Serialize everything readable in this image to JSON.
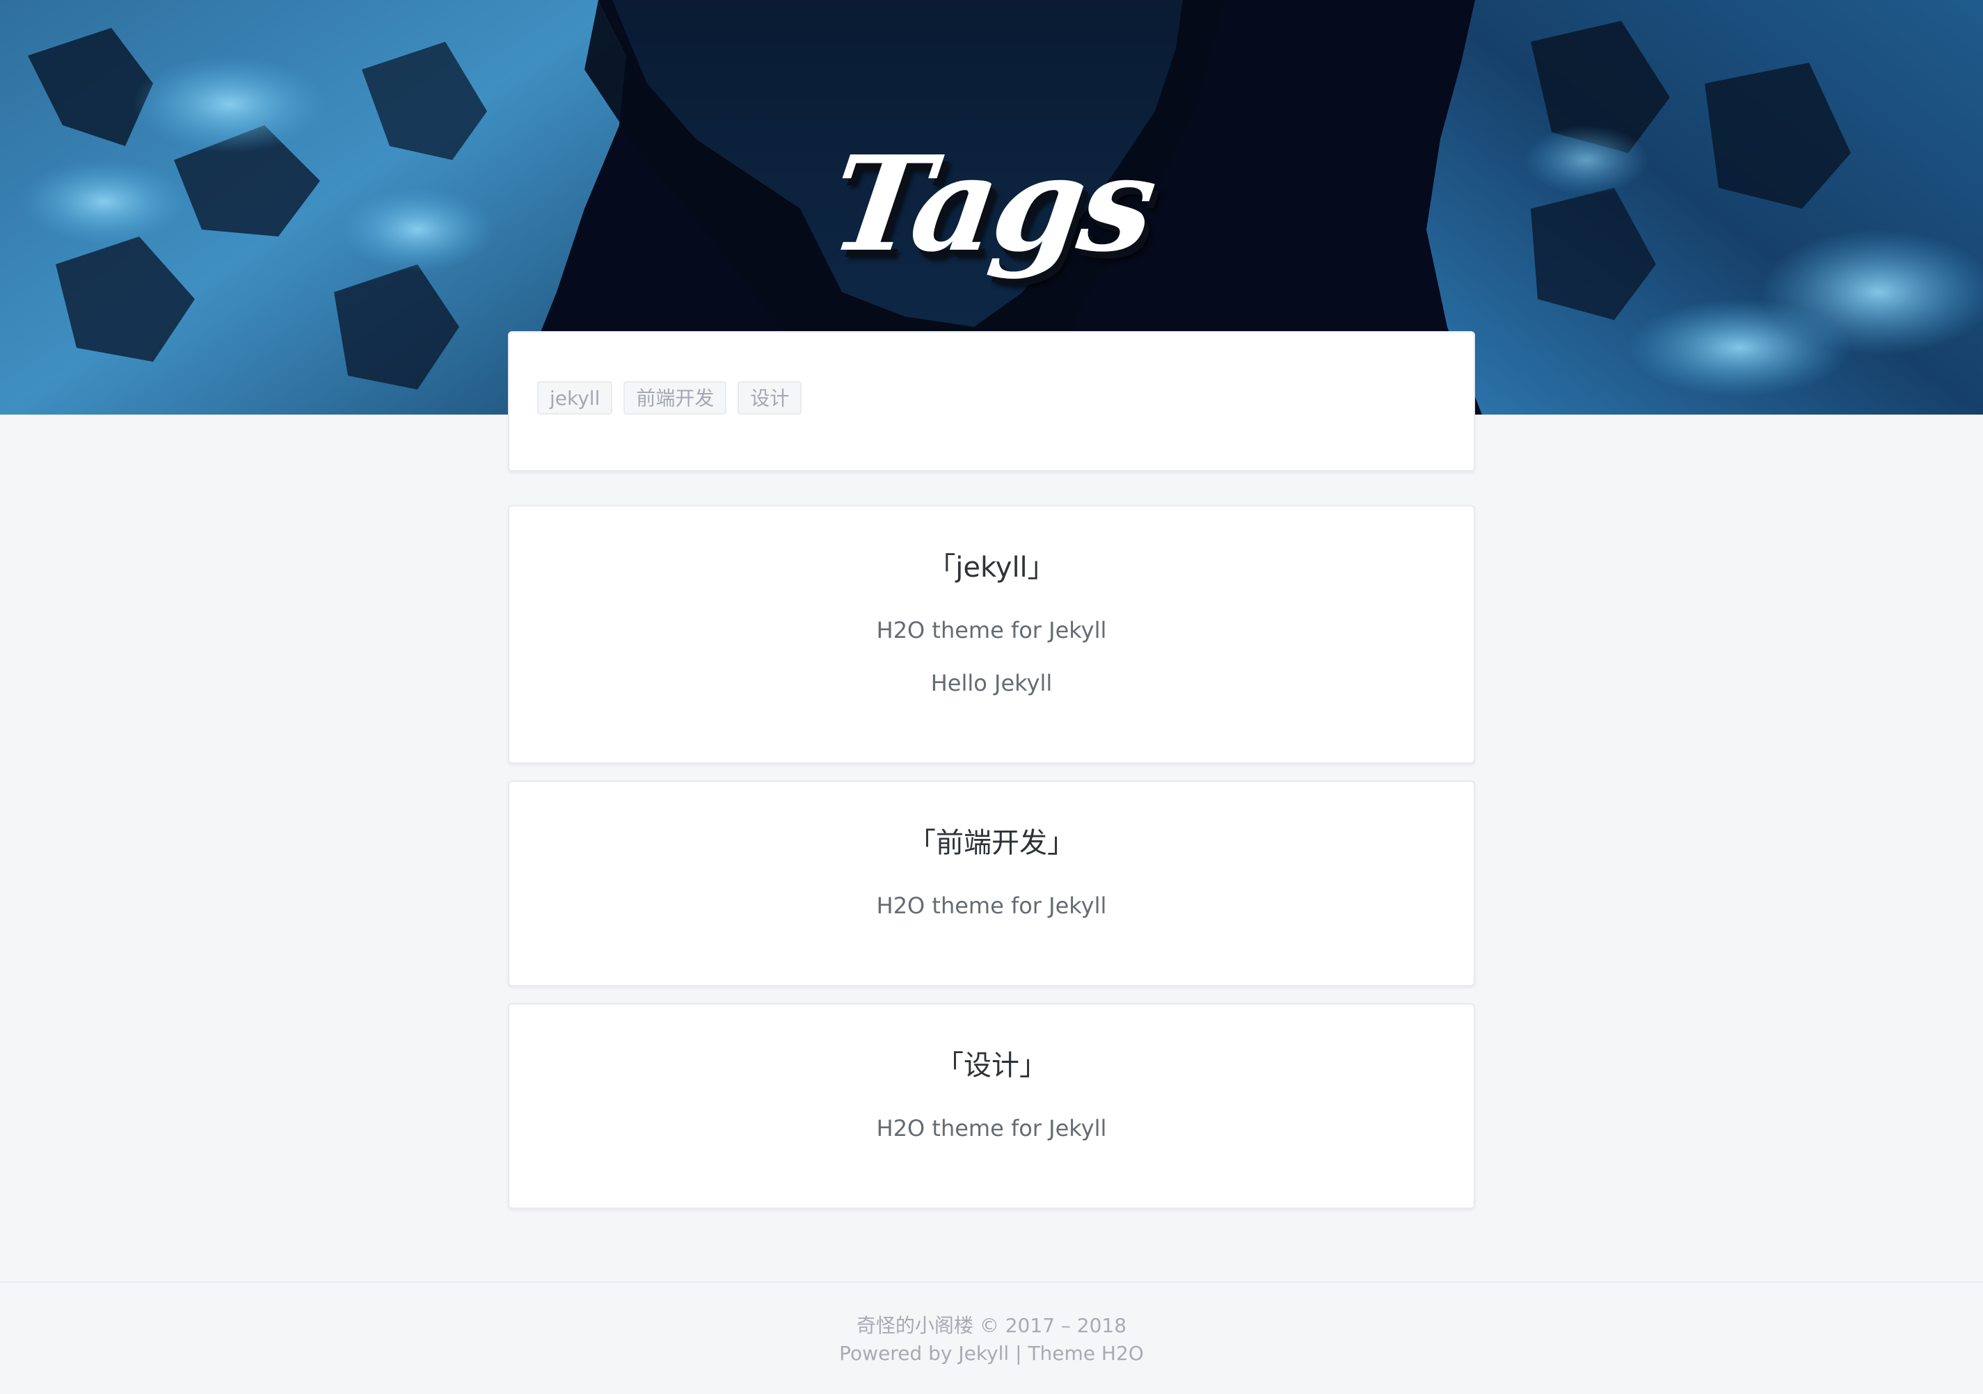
{
  "hero": {
    "title": "Tags"
  },
  "tags": [
    {
      "label": "jekyll"
    },
    {
      "label": "前端开发"
    },
    {
      "label": "设计"
    }
  ],
  "sections": [
    {
      "title": "「jekyll」",
      "posts": [
        "H2O theme for Jekyll",
        "Hello Jekyll"
      ]
    },
    {
      "title": "「前端开发」",
      "posts": [
        "H2O theme for Jekyll"
      ]
    },
    {
      "title": "「设计」",
      "posts": [
        "H2O theme for Jekyll"
      ]
    }
  ],
  "footer": {
    "site_name": "奇怪的小阁楼",
    "copyright": "© 2017 – 2018",
    "powered_prefix": "Powered by",
    "powered_link": "Jekyll",
    "separator": "|",
    "theme_link": "Theme H2O"
  },
  "colors": {
    "hero_background": "#06122a",
    "page_background": "#f5f6f8",
    "card_background": "#ffffff",
    "tag_chip_text": "#a3a8b1",
    "section_title_text": "#2f3338",
    "post_link_text": "#666b73",
    "footer_text": "#a7abb2"
  }
}
